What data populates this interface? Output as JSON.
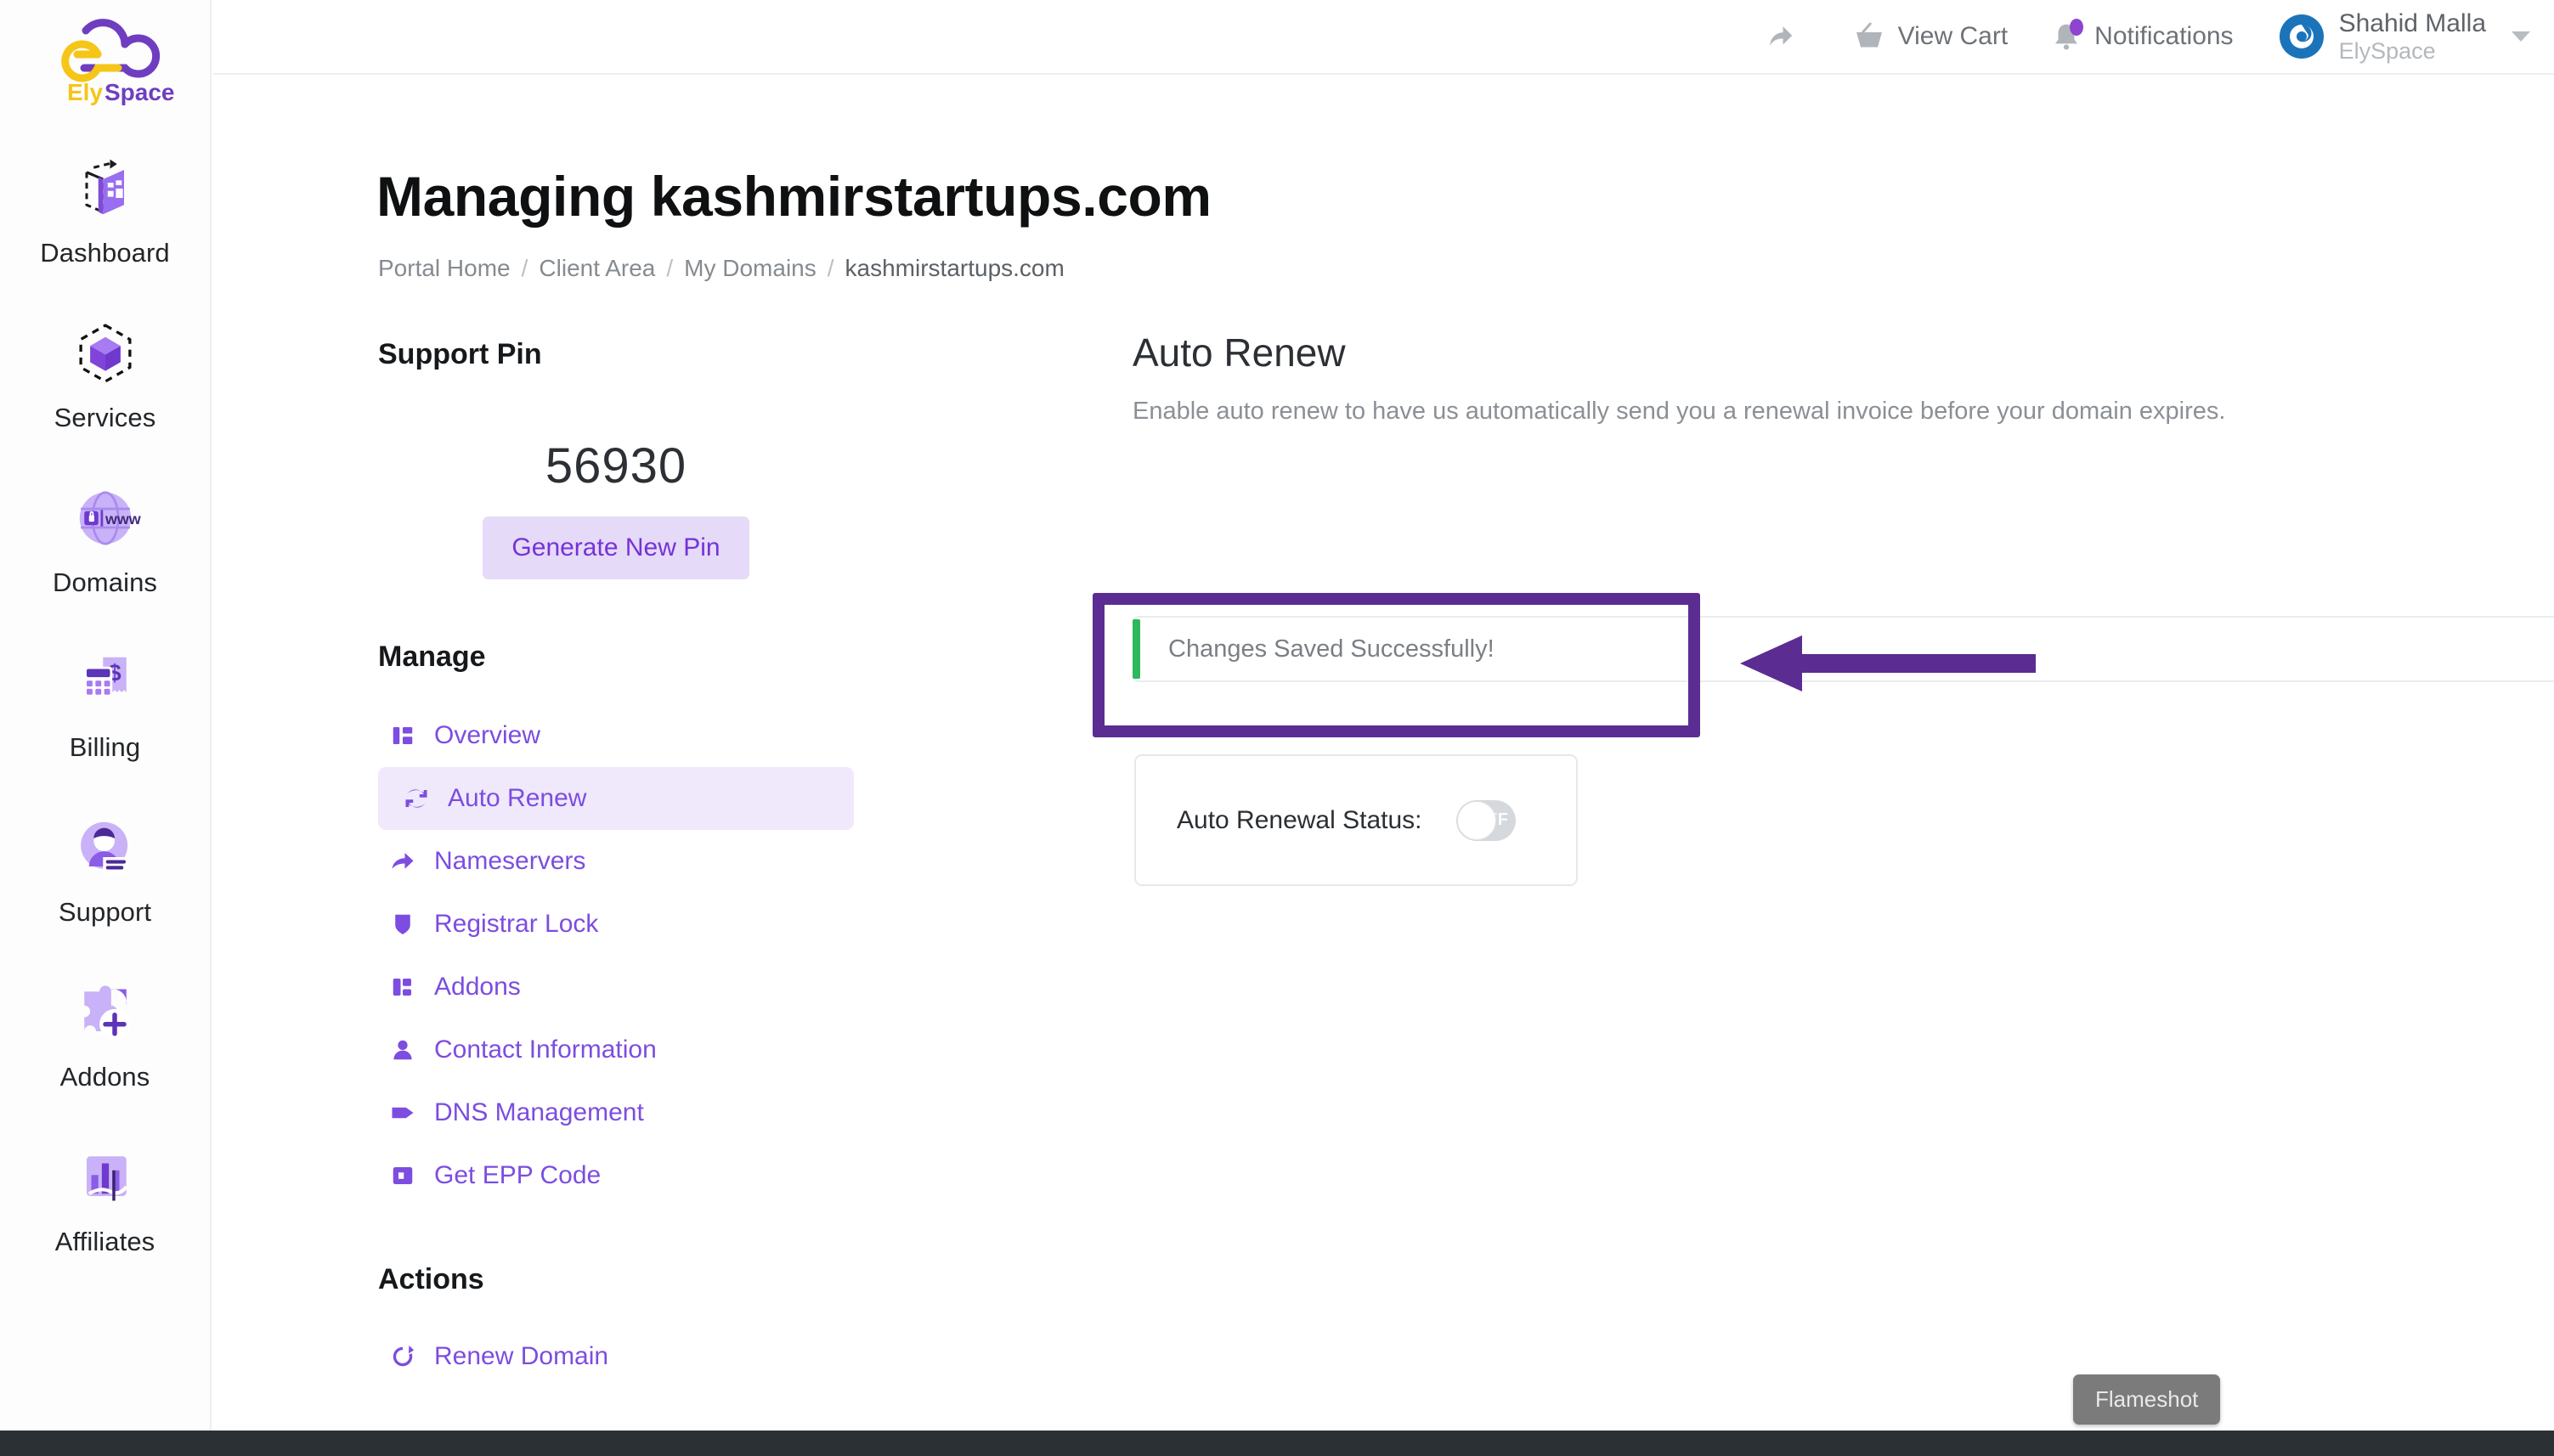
{
  "rail": {
    "logo_mark": "elyspace-logo",
    "logo_text_a": "Ely",
    "logo_text_b": "Space",
    "items": [
      {
        "label": "Dashboard",
        "icon": "dashboard-icon"
      },
      {
        "label": "Services",
        "icon": "services-cube-icon"
      },
      {
        "label": "Domains",
        "icon": "domains-globe-www-icon"
      },
      {
        "label": "Billing",
        "icon": "billing-invoice-icon"
      },
      {
        "label": "Support",
        "icon": "support-agent-icon"
      },
      {
        "label": "Addons",
        "icon": "addons-puzzle-plus-icon"
      },
      {
        "label": "Affiliates",
        "icon": "affiliates-chart-icon"
      }
    ]
  },
  "topbar": {
    "share_icon": "share-arrow-icon",
    "cart_icon": "shopping-basket-icon",
    "cart_label": "View Cart",
    "notifications_icon": "bell-icon",
    "notifications_label": "Notifications",
    "has_notification_dot": true,
    "avatar_icon": "user-avatar-icon",
    "user_name": "Shahid Malla",
    "user_org": "ElySpace",
    "caret_icon": "chevron-down-icon"
  },
  "page": {
    "title": "Managing kashmirstartups.com",
    "breadcrumb": [
      {
        "label": "Portal Home",
        "current": false
      },
      {
        "label": "Client Area",
        "current": false
      },
      {
        "label": "My Domains",
        "current": false
      },
      {
        "label": "kashmirstartups.com",
        "current": true
      }
    ],
    "breadcrumb_separator": "/"
  },
  "support_pin": {
    "heading": "Support Pin",
    "value": "56930",
    "button_label": "Generate New Pin"
  },
  "manage": {
    "heading": "Manage",
    "items": [
      {
        "label": "Overview",
        "icon": "layout-overview-icon",
        "active": false
      },
      {
        "label": "Auto Renew",
        "icon": "refresh-cycle-icon",
        "active": true
      },
      {
        "label": "Nameservers",
        "icon": "arrow-forward-icon",
        "active": false
      },
      {
        "label": "Registrar Lock",
        "icon": "shield-icon",
        "active": false
      },
      {
        "label": "Addons",
        "icon": "addons-blocks-icon",
        "active": false
      },
      {
        "label": "Contact Information",
        "icon": "person-icon",
        "active": false
      },
      {
        "label": "DNS Management",
        "icon": "tag-icon",
        "active": false
      },
      {
        "label": "Get EPP Code",
        "icon": "code-square-icon",
        "active": false
      }
    ]
  },
  "actions": {
    "heading": "Actions",
    "items": [
      {
        "label": "Renew Domain",
        "icon": "renew-circular-arrow-icon"
      }
    ]
  },
  "auto_renew": {
    "title": "Auto Renew",
    "description": "Enable auto renew to have us automatically send you a renewal invoice before your domain expires.",
    "alert_message": "Changes Saved Successfully!",
    "alert_accent_color": "#2eb85c",
    "status_label": "Auto Renewal Status:",
    "status_value": "OFF",
    "status_on": false
  },
  "annotation": {
    "color": "#5b2c91",
    "rect_target": "alert-success-box",
    "arrow_direction": "left"
  },
  "overlay": {
    "flameshot_label": "Flameshot"
  },
  "colors": {
    "brand_purple": "#7c4de0",
    "brand_purple_dark": "#5b2c91",
    "brand_yellow": "#f5c518",
    "success_green": "#2eb85c",
    "pin_button_bg": "#e5daf7",
    "active_nav_bg": "#efe9fb"
  }
}
